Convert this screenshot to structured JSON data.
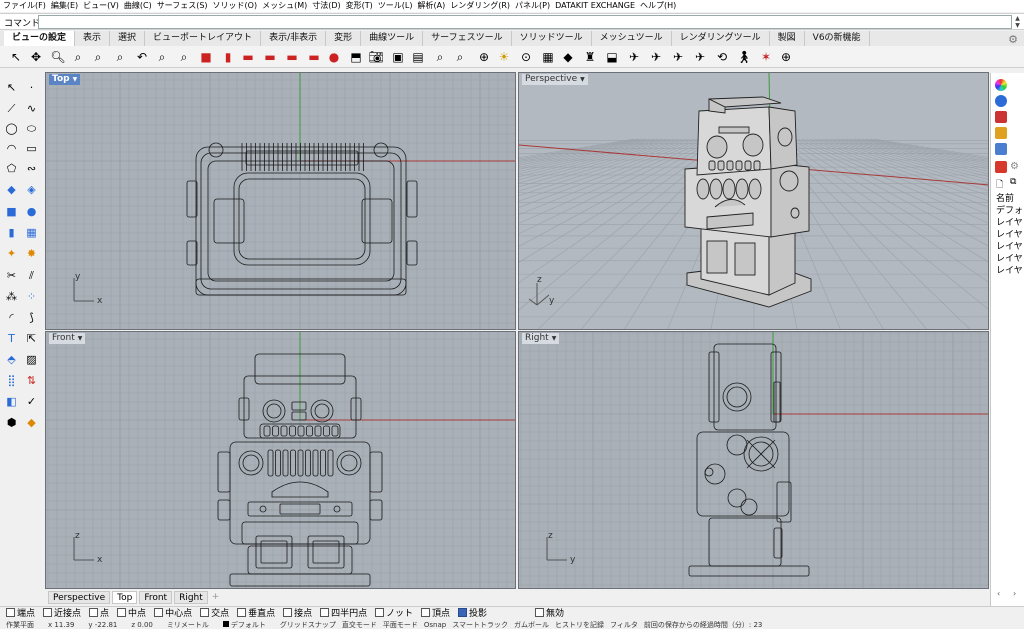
{
  "menu": [
    "ファイル(F)",
    "編集(E)",
    "ビュー(V)",
    "曲線(C)",
    "サーフェス(S)",
    "ソリッド(O)",
    "メッシュ(M)",
    "寸法(D)",
    "変形(T)",
    "ツール(L)",
    "解析(A)",
    "レンダリング(R)",
    "パネル(P)",
    "DATAKIT EXCHANGE",
    "ヘルプ(H)"
  ],
  "command": {
    "label": "コマンド:",
    "value": ""
  },
  "tabs": [
    "ビューの設定",
    "表示",
    "選択",
    "ビューポートレイアウト",
    "表示/非表示",
    "変形",
    "曲線ツール",
    "サーフェスツール",
    "ソリッドツール",
    "メッシュツール",
    "レンダリングツール",
    "製図",
    "V6の新機能"
  ],
  "active_tab": "ビューの設定",
  "viewports": {
    "top": {
      "title": "Top",
      "axis_y": "y",
      "axis_x": "x"
    },
    "perspective": {
      "title": "Perspective",
      "axis_y": "z",
      "axis_x": "y"
    },
    "front": {
      "title": "Front",
      "axis_y": "z",
      "axis_x": "x"
    },
    "right": {
      "title": "Right",
      "axis_y": "z",
      "axis_x": "y"
    }
  },
  "viewport_tabs": [
    "Perspective",
    "Top",
    "Front",
    "Right"
  ],
  "active_viewport_tab": "Top",
  "layers_panel": {
    "header": "名前",
    "items": [
      "デフォ",
      "レイヤ",
      "レイヤ",
      "レイヤ",
      "レイヤ",
      "レイヤ"
    ]
  },
  "osnaps": [
    {
      "label": "端点",
      "checked": false
    },
    {
      "label": "近接点",
      "checked": false
    },
    {
      "label": "点",
      "checked": false
    },
    {
      "label": "中点",
      "checked": false
    },
    {
      "label": "中心点",
      "checked": false
    },
    {
      "label": "交点",
      "checked": false
    },
    {
      "label": "垂直点",
      "checked": false
    },
    {
      "label": "接点",
      "checked": false
    },
    {
      "label": "四半円点",
      "checked": false
    },
    {
      "label": "ノット",
      "checked": false
    },
    {
      "label": "頂点",
      "checked": false
    },
    {
      "label": "投影",
      "checked": true
    },
    {
      "label": "無効",
      "checked": false
    }
  ],
  "status": {
    "plane": "作業平面",
    "x": "x 11.39",
    "y": "y -22.81",
    "z": "z 0.00",
    "unit": "ミリメートル",
    "layer": "デフォルト",
    "items": [
      "グリッドスナップ",
      "直交モード",
      "平面モード",
      "Osnap",
      "スマートトラック",
      "ガムボール",
      "ヒストリを記録",
      "フィルタ",
      "前回の保存からの経過時間（分）: 23"
    ]
  },
  "colors": {
    "viewport_bg": "#a9b0b8",
    "grid": "#9aa1a9",
    "grid_major": "#8c939b",
    "axis_x": "#a83a3a",
    "axis_y": "#3a9a3a",
    "wire": "#1a1a1a",
    "active_title": "#5b84c4"
  }
}
